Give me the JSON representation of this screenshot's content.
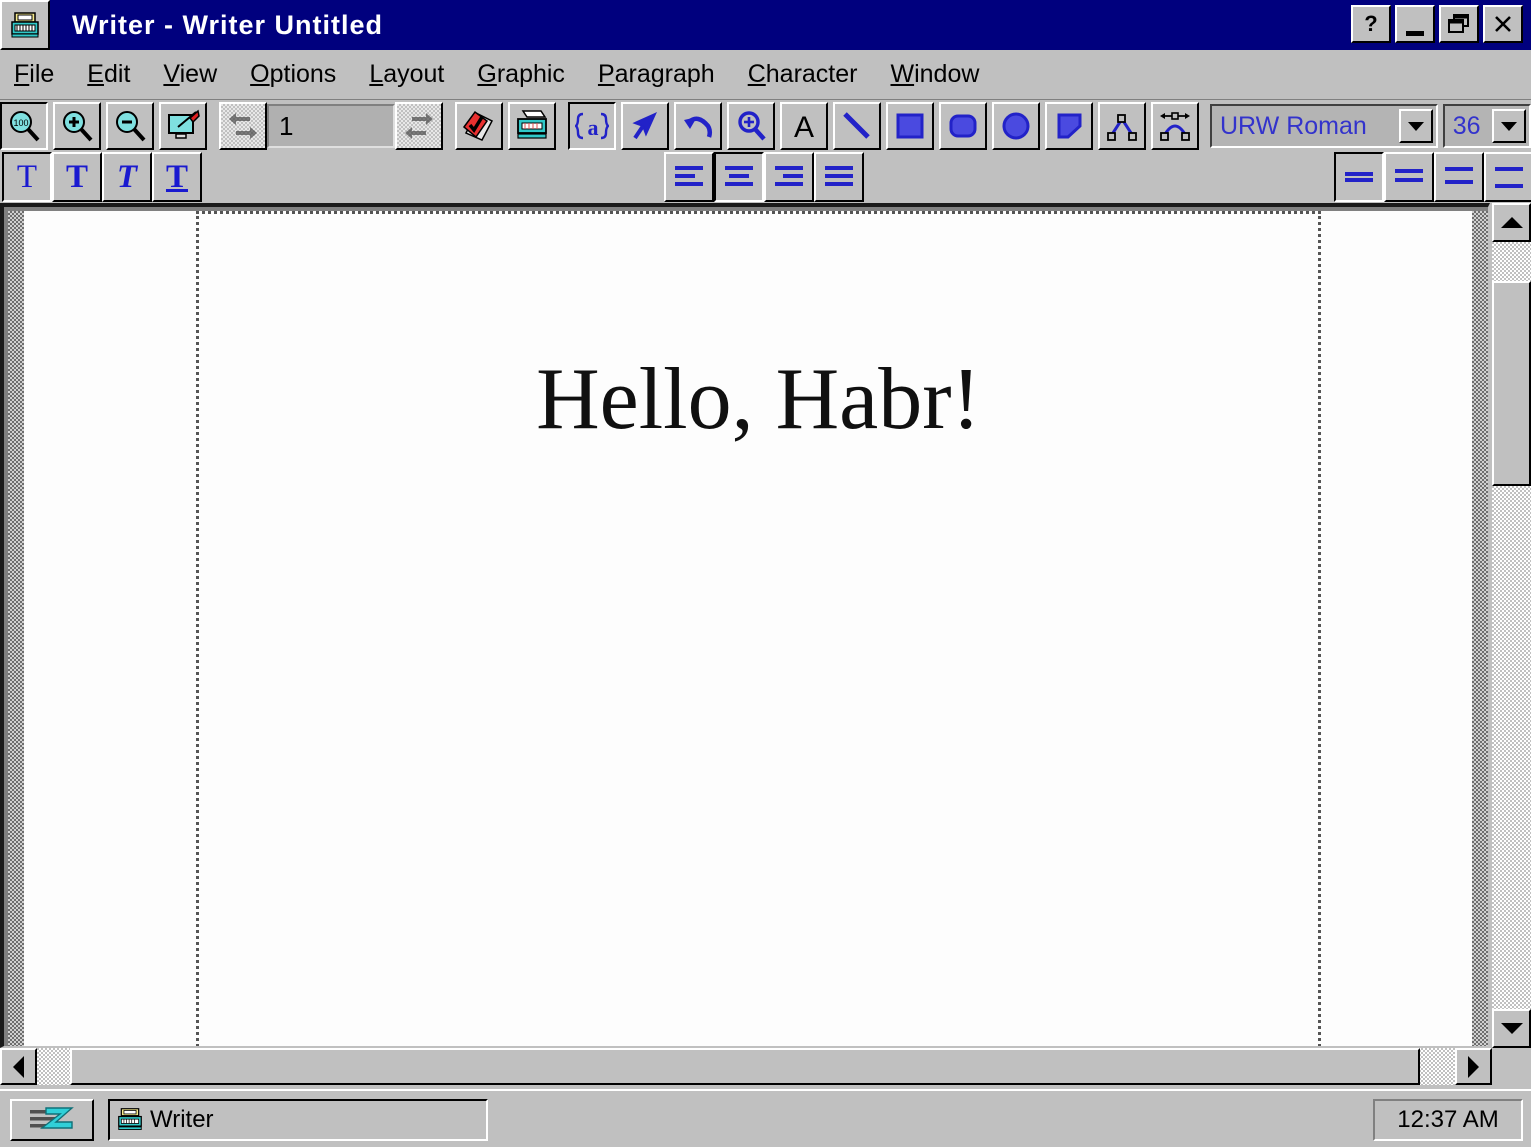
{
  "window": {
    "title": "Writer - Writer Untitled",
    "sys_icon": "typewriter-icon",
    "buttons": [
      {
        "name": "help-button",
        "label": "?"
      },
      {
        "name": "minimize-button",
        "label": "_"
      },
      {
        "name": "restore-button",
        "label": "restore-icon"
      },
      {
        "name": "close-button",
        "label": "✕"
      }
    ]
  },
  "menubar": {
    "items": [
      {
        "label": "File",
        "accel": "F"
      },
      {
        "label": "Edit",
        "accel": "E"
      },
      {
        "label": "View",
        "accel": "V"
      },
      {
        "label": "Options",
        "accel": "O"
      },
      {
        "label": "Layout",
        "accel": "L"
      },
      {
        "label": "Graphic",
        "accel": "G"
      },
      {
        "label": "Paragraph",
        "accel": "P"
      },
      {
        "label": "Character",
        "accel": "C"
      },
      {
        "label": "Window",
        "accel": "W"
      }
    ]
  },
  "toolbar_main": {
    "buttons": [
      {
        "name": "zoom-100-button",
        "icon": "magnifier-100-icon",
        "pressed": true
      },
      {
        "name": "zoom-in-button",
        "icon": "magnifier-plus-icon",
        "pressed": false
      },
      {
        "name": "zoom-out-button",
        "icon": "magnifier-minus-icon",
        "pressed": false
      },
      {
        "name": "edit-mode-button",
        "icon": "pencil-screen-icon",
        "pressed": false
      }
    ],
    "page_nav": {
      "prev_label": "previous-page-icon",
      "next_label": "next-page-icon",
      "page_value": "1"
    },
    "buttons2": [
      {
        "name": "save-button",
        "icon": "save-check-icon",
        "pressed": false
      },
      {
        "name": "print-button",
        "icon": "printer-icon",
        "pressed": false
      }
    ],
    "tools": [
      {
        "name": "text-tool-button",
        "icon": "text-a-icon",
        "pressed": true
      },
      {
        "name": "select-tool-button",
        "icon": "arrow-pointer-icon",
        "pressed": false
      },
      {
        "name": "undo-button",
        "icon": "undo-arrow-icon",
        "pressed": false
      },
      {
        "name": "zoom-tool-button",
        "icon": "magnifier-icon",
        "pressed": false
      },
      {
        "name": "insert-text-button",
        "icon": "letter-a-icon",
        "pressed": false
      },
      {
        "name": "line-tool-button",
        "icon": "line-icon",
        "pressed": false
      },
      {
        "name": "rectangle-tool-button",
        "icon": "rectangle-icon",
        "pressed": false
      },
      {
        "name": "rounded-rect-button",
        "icon": "rounded-rect-icon",
        "pressed": false
      },
      {
        "name": "ellipse-tool-button",
        "icon": "ellipse-icon",
        "pressed": false
      },
      {
        "name": "polygon-tool-button",
        "icon": "polygon-icon",
        "pressed": false
      },
      {
        "name": "polyline-tool-button",
        "icon": "polyline-icon",
        "pressed": false
      },
      {
        "name": "bezier-tool-button",
        "icon": "bezier-curve-icon",
        "pressed": false
      }
    ],
    "font_name": {
      "value": "URW Roman",
      "arrow": "chevron-down-icon"
    },
    "font_size": {
      "value": "36",
      "arrow": "chevron-down-icon"
    }
  },
  "toolbar_format": {
    "styles": [
      {
        "name": "normal-button",
        "glyph": "T",
        "pressed": true
      },
      {
        "name": "bold-button",
        "glyph": "T",
        "pressed": false
      },
      {
        "name": "italic-button",
        "glyph": "T",
        "pressed": false
      },
      {
        "name": "underline-button",
        "glyph": "T",
        "pressed": false
      }
    ],
    "align": [
      {
        "name": "align-left-button",
        "icon": "align-left-icon",
        "pressed": false
      },
      {
        "name": "align-center-button",
        "icon": "align-center-icon",
        "pressed": true
      },
      {
        "name": "align-right-button",
        "icon": "align-right-icon",
        "pressed": false
      },
      {
        "name": "align-justify-button",
        "icon": "align-justify-icon",
        "pressed": false
      }
    ],
    "spacing": [
      {
        "name": "line-spacing-single-button",
        "icon": "spacing-single-icon",
        "pressed": true
      },
      {
        "name": "line-spacing-15-button",
        "icon": "spacing-1-5-icon",
        "pressed": false
      },
      {
        "name": "line-spacing-double-button",
        "icon": "spacing-double-icon",
        "pressed": false
      },
      {
        "name": "line-spacing-extra-button",
        "icon": "spacing-extra-icon",
        "pressed": false
      }
    ]
  },
  "document": {
    "text": "Hello, Habr!"
  },
  "scrollbars": {
    "vertical": {
      "up": "scroll-up-icon",
      "down": "scroll-down-icon"
    },
    "horizontal": {
      "left": "scroll-left-icon",
      "right": "scroll-right-icon"
    }
  },
  "taskbar": {
    "start": {
      "icon": "start-logo-icon"
    },
    "items": [
      {
        "label": "Writer",
        "icon": "typewriter-icon"
      }
    ],
    "clock": "12:37 AM"
  },
  "colors": {
    "titlebar": "#00007e",
    "face": "#c0c0c0",
    "tool_blue": "#2222c8",
    "combo_text": "#3333cc",
    "page": "#fdfdfd"
  }
}
